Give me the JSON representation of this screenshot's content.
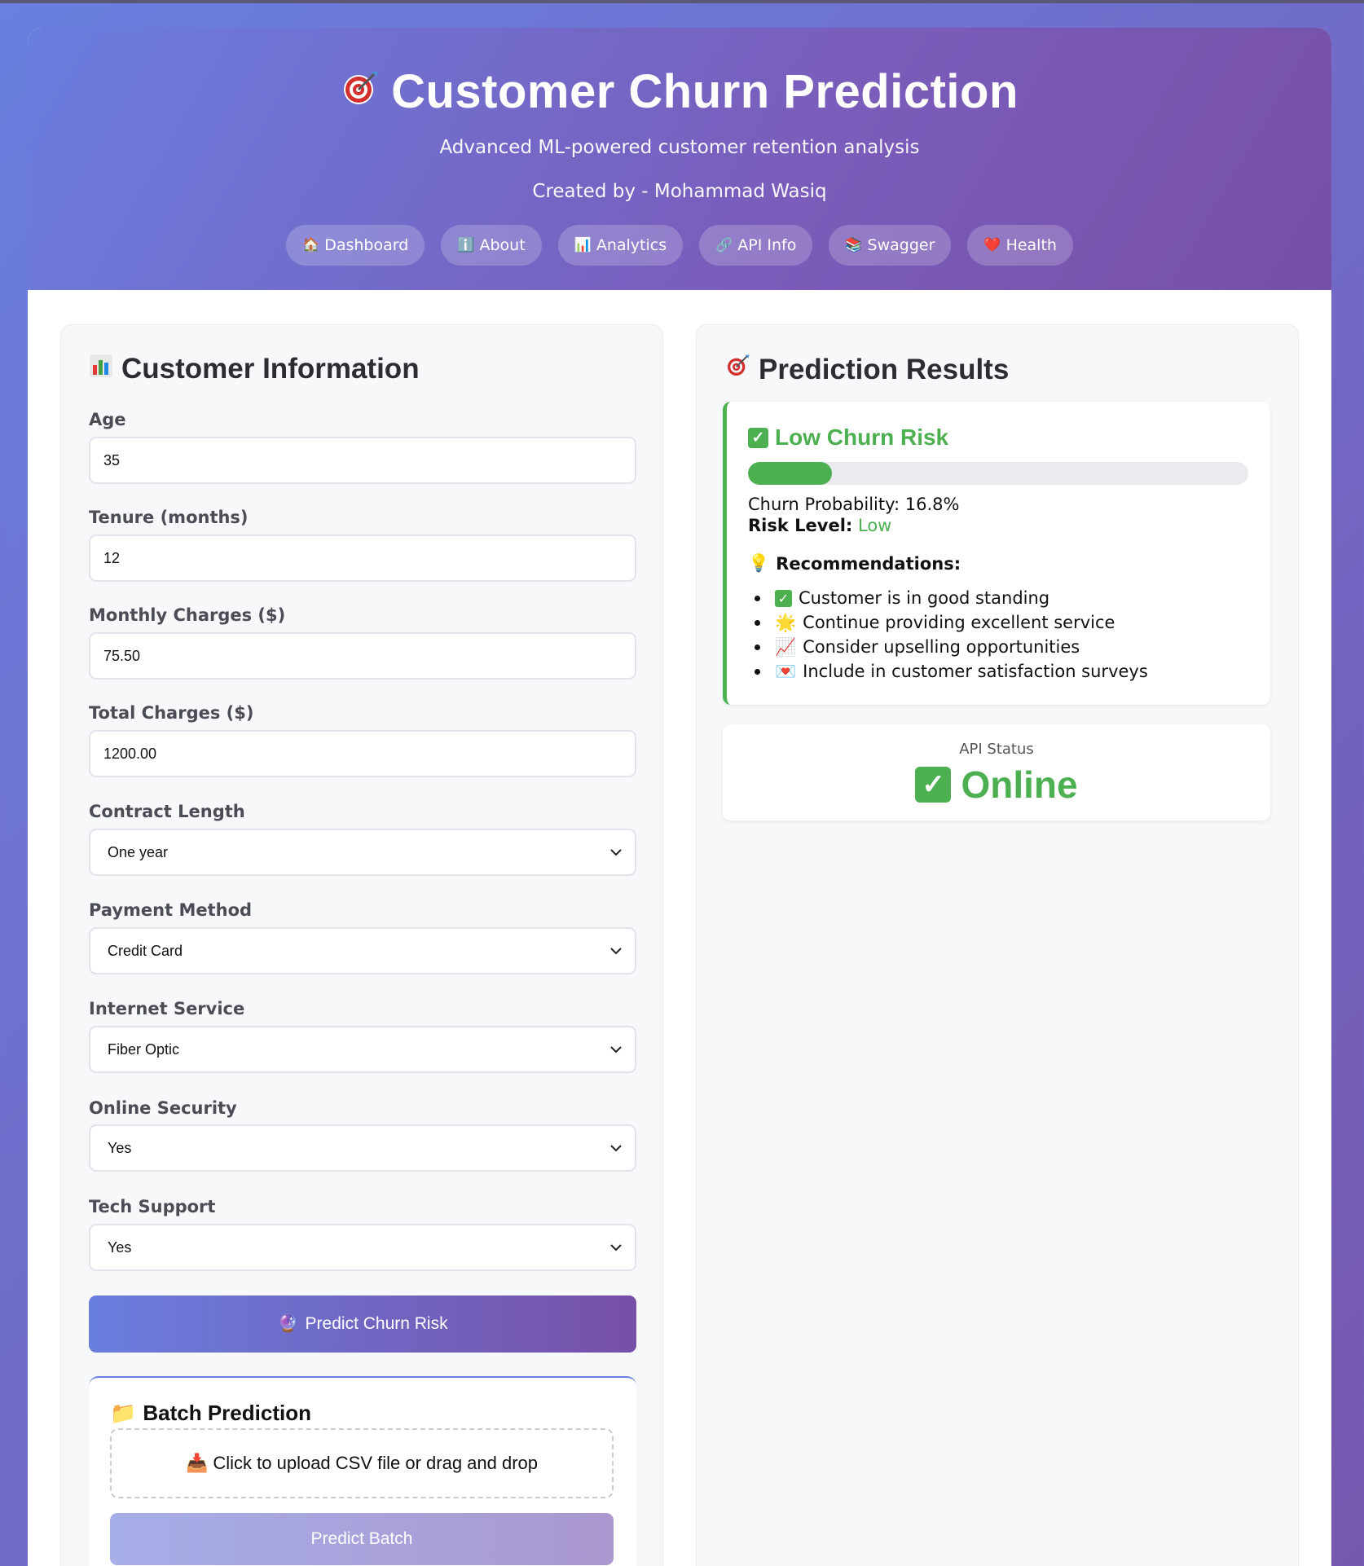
{
  "header": {
    "title": "Customer Churn Prediction",
    "subtitle": "Advanced ML-powered customer retention analysis",
    "author": "Created by - Mohammad Wasiq",
    "nav": [
      {
        "label": "Dashboard",
        "icon": "house-icon"
      },
      {
        "label": "About",
        "icon": "info-icon"
      },
      {
        "label": "Analytics",
        "icon": "bar-chart-icon"
      },
      {
        "label": "API Info",
        "icon": "link-icon"
      },
      {
        "label": "Swagger",
        "icon": "books-icon"
      },
      {
        "label": "Health",
        "icon": "heart-icon"
      }
    ]
  },
  "form": {
    "title": "Customer Information",
    "fields": {
      "age": {
        "label": "Age",
        "value": "35"
      },
      "tenure": {
        "label": "Tenure (months)",
        "value": "12"
      },
      "monthly": {
        "label": "Monthly Charges ($)",
        "value": "75.50"
      },
      "total": {
        "label": "Total Charges ($)",
        "value": "1200.00"
      },
      "contract": {
        "label": "Contract Length",
        "value": "One year"
      },
      "payment": {
        "label": "Payment Method",
        "value": "Credit Card"
      },
      "internet": {
        "label": "Internet Service",
        "value": "Fiber Optic"
      },
      "security": {
        "label": "Online Security",
        "value": "Yes"
      },
      "support": {
        "label": "Tech Support",
        "value": "Yes"
      }
    },
    "predict_label": "Predict Churn Risk",
    "batch": {
      "title": "Batch Prediction",
      "upload_text": "Click to upload CSV file or drag and drop",
      "button_label": "Predict Batch"
    }
  },
  "results": {
    "title": "Prediction Results",
    "risk_title": "Low Churn Risk",
    "probability_fraction": 0.168,
    "probability_text": "Churn Probability: 16.8%",
    "risk_level_label": "Risk Level:",
    "risk_level_value": "Low",
    "recommendations_title": "Recommendations:",
    "recommendations": [
      {
        "icon": "check-icon",
        "text": "Customer is in good standing"
      },
      {
        "icon": "star-icon",
        "text": "Continue providing excellent service"
      },
      {
        "icon": "trend-up-icon",
        "text": "Consider upselling opportunities"
      },
      {
        "icon": "mail-heart-icon",
        "text": "Include in customer satisfaction surveys"
      }
    ]
  },
  "api_status": {
    "label": "API Status",
    "value": "Online"
  },
  "colors": {
    "accent_start": "#6a7ede",
    "accent_end": "#7650a8",
    "success": "#4caf50"
  }
}
